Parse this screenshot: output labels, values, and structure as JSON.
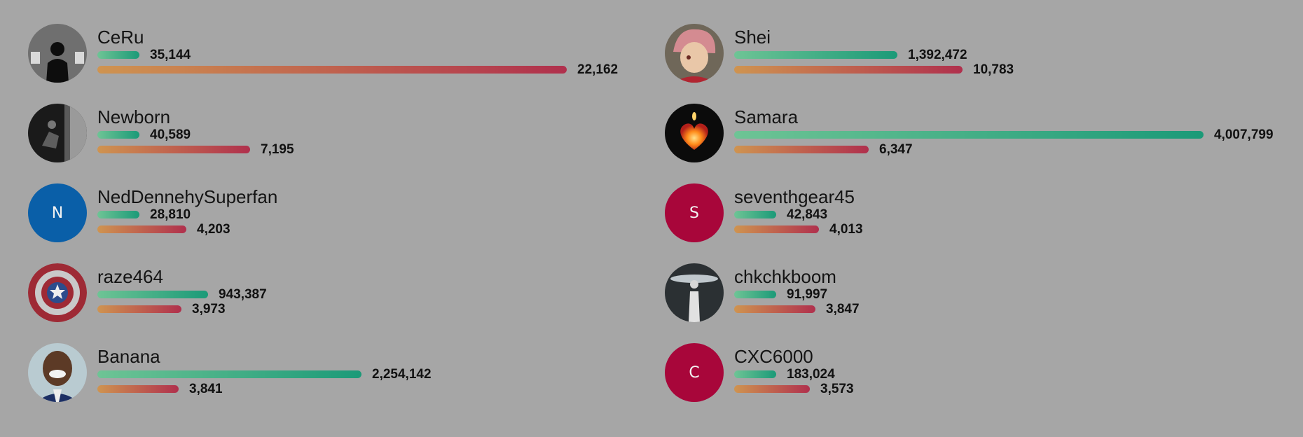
{
  "leaderboard": {
    "left": [
      {
        "name": "CeRu",
        "avatar_icon": "silhouette-photo-avatar",
        "green_value": "35,144",
        "green_fraction": 0.0088,
        "red_value": "22,162",
        "red_fraction": 1.0
      },
      {
        "name": "Newborn",
        "avatar_icon": "dark-photo-avatar",
        "green_value": "40,589",
        "green_fraction": 0.0101,
        "red_value": "7,195",
        "red_fraction": 0.3247
      },
      {
        "name": "NedDennehySuperfan",
        "avatar_icon": "letter-avatar",
        "avatar_letter": "N",
        "avatar_color": "#0a5fa8",
        "green_value": "28,810",
        "green_fraction": 0.0072,
        "red_value": "4,203",
        "red_fraction": 0.1897
      },
      {
        "name": "raze464",
        "avatar_icon": "shield-avatar",
        "green_value": "943,387",
        "green_fraction": 0.2354,
        "red_value": "3,973",
        "red_fraction": 0.1793
      },
      {
        "name": "Banana",
        "avatar_icon": "smiling-man-avatar",
        "green_value": "2,254,142",
        "green_fraction": 0.5624,
        "red_value": "3,841",
        "red_fraction": 0.1733
      }
    ],
    "right": [
      {
        "name": "Shei",
        "avatar_icon": "anime-character-avatar",
        "green_value": "1,392,472",
        "green_fraction": 0.3474,
        "red_value": "10,783",
        "red_fraction": 0.4866
      },
      {
        "name": "Samara",
        "avatar_icon": "glowing-heart-avatar",
        "green_value": "4,007,799",
        "green_fraction": 1.0,
        "red_value": "6,347",
        "red_fraction": 0.2864
      },
      {
        "name": "seventhgear45",
        "avatar_icon": "letter-avatar",
        "avatar_letter": "S",
        "avatar_color": "#a8063a",
        "green_value": "42,843",
        "green_fraction": 0.0107,
        "red_value": "4,013",
        "red_fraction": 0.1811
      },
      {
        "name": "chkchkboom",
        "avatar_icon": "figure-photo-avatar",
        "green_value": "91,997",
        "green_fraction": 0.023,
        "red_value": "3,847",
        "red_fraction": 0.1736
      },
      {
        "name": "CXC6000",
        "avatar_icon": "letter-avatar",
        "avatar_letter": "C",
        "avatar_color": "#a8063a",
        "green_value": "183,024",
        "green_fraction": 0.0457,
        "red_value": "3,573",
        "red_fraction": 0.1612
      }
    ]
  }
}
